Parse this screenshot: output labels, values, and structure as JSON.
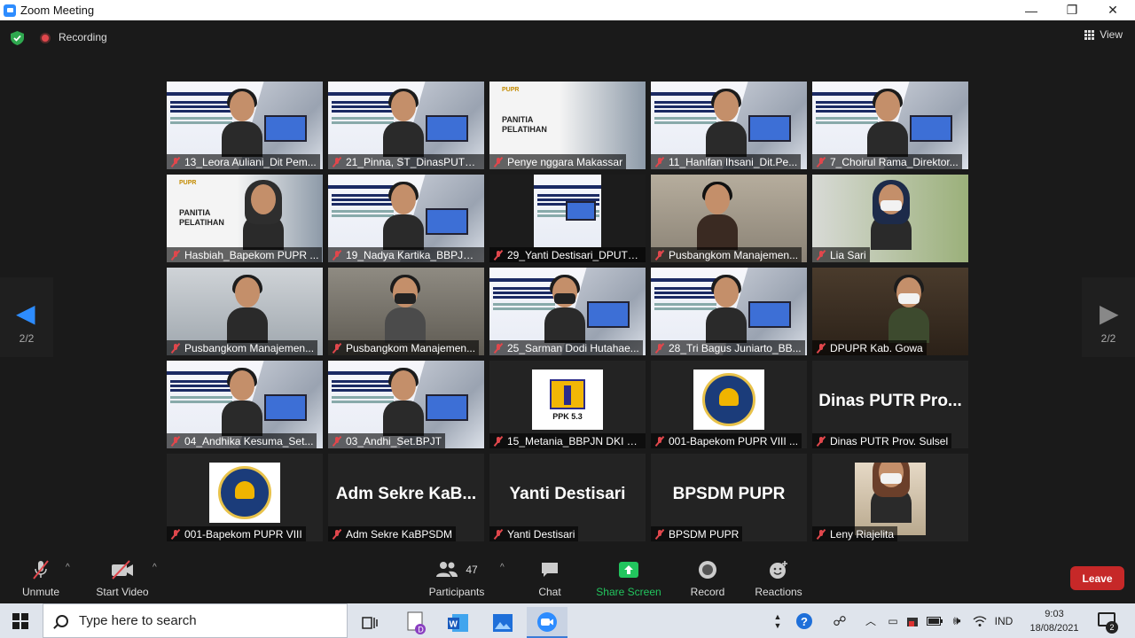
{
  "window": {
    "title": "Zoom Meeting",
    "minimize": "—",
    "restore": "❐",
    "close": "✕"
  },
  "meeting": {
    "recording_label": "Recording",
    "view_label": "View",
    "page_left": "2/2",
    "page_right": "2/2"
  },
  "tiles": [
    {
      "name": "13_Leora Auliani_Dit Pem...",
      "kind": "slide-person"
    },
    {
      "name": "21_Pinna, ST_DinasPUTRS...",
      "kind": "slide-person"
    },
    {
      "name": "Penye nggara Makassar",
      "kind": "panitia"
    },
    {
      "name": "11_Hanifan Ihsani_Dit.Pe...",
      "kind": "slide-person"
    },
    {
      "name": "7_Choirul Rama_Direktor...",
      "kind": "slide-person"
    },
    {
      "name": "Hasbiah_Bapekom PUPR ...",
      "kind": "panitia-person"
    },
    {
      "name": "19_Nadya Kartika_BBPJN ...",
      "kind": "slide-person"
    },
    {
      "name": "29_Yanti Destisari_DPUTR...",
      "kind": "small-slide"
    },
    {
      "name": "Pusbangkom Manajemen...",
      "kind": "man"
    },
    {
      "name": "Lia Sari",
      "kind": "hijab-mask"
    },
    {
      "name": "Pusbangkom Manajemen...",
      "kind": "office-person"
    },
    {
      "name": "Pusbangkom Manajemen...",
      "kind": "wall-mask"
    },
    {
      "name": "25_Sarman Dodi Hutahae...",
      "kind": "slide-headset"
    },
    {
      "name": "28_Tri Bagus Juniarto_BB...",
      "kind": "slide-person"
    },
    {
      "name": "DPUPR Kab. Gowa",
      "kind": "dark-room"
    },
    {
      "name": "04_Andhika Kesuma_Set...",
      "kind": "slide-person"
    },
    {
      "name": "03_Andhi_Set.BPJT",
      "kind": "slide-person"
    },
    {
      "name": "15_Metania_BBPJN DKI Ja...",
      "kind": "ppk"
    },
    {
      "name": "001-Bapekom PUPR VIII ...",
      "kind": "bapekom"
    },
    {
      "name": "Dinas PUTR Prov. Sulsel",
      "kind": "text",
      "big": "Dinas PUTR Pro..."
    },
    {
      "name": "001-Bapekom PUPR VIII",
      "kind": "bapekom"
    },
    {
      "name": "Adm Sekre KaBPSDM",
      "kind": "text",
      "big": "Adm Sekre KaB..."
    },
    {
      "name": "Yanti Destisari",
      "kind": "text",
      "big": "Yanti Destisari"
    },
    {
      "name": "BPSDM PUPR",
      "kind": "text",
      "big": "BPSDM PUPR"
    },
    {
      "name": "Leny Riajelita",
      "kind": "leny"
    }
  ],
  "tile_text": {
    "panitia": "PANITIA\nPELATIHAN",
    "pupr": "PUPR",
    "ppk": "PPK 5.3"
  },
  "toolbar": {
    "unmute": "Unmute",
    "start_video": "Start Video",
    "participants": "Participants",
    "participants_count": "47",
    "chat": "Chat",
    "share_screen": "Share Screen",
    "record": "Record",
    "reactions": "Reactions",
    "leave": "Leave",
    "share_color": "#22c55e",
    "leave_color": "#c62828"
  },
  "taskbar": {
    "search_placeholder": "Type here to search",
    "language": "IND",
    "time": "9:03",
    "date": "18/08/2021",
    "notifications": "2"
  }
}
